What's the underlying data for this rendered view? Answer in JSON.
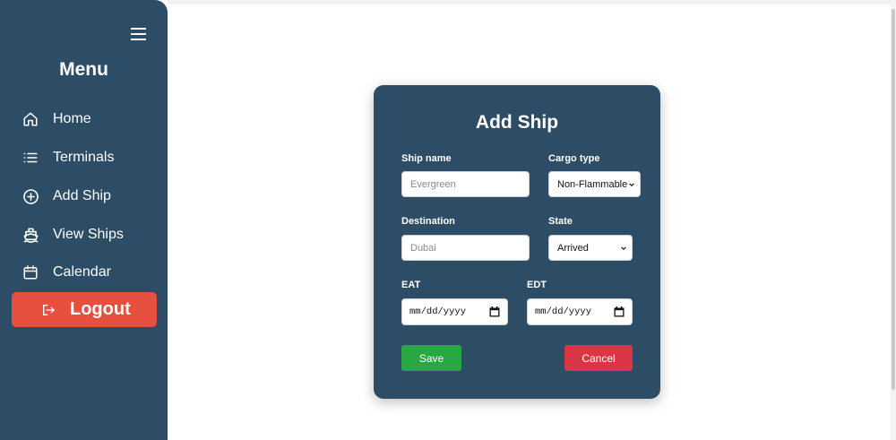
{
  "sidebar": {
    "title": "Menu",
    "items": [
      {
        "label": "Home",
        "icon": "home-icon"
      },
      {
        "label": "Terminals",
        "icon": "list-icon"
      },
      {
        "label": "Add Ship",
        "icon": "plus-circle-icon"
      },
      {
        "label": "View Ships",
        "icon": "ship-icon"
      },
      {
        "label": "Calendar",
        "icon": "calendar-icon"
      }
    ],
    "logout_label": "Logout"
  },
  "form": {
    "title": "Add Ship",
    "ship_name": {
      "label": "Ship name",
      "placeholder": "Evergreen"
    },
    "cargo_type": {
      "label": "Cargo type",
      "value": "Non-Flammable"
    },
    "destination": {
      "label": "Destination",
      "placeholder": "Dubai"
    },
    "state": {
      "label": "State",
      "value": "Arrived"
    },
    "eat": {
      "label": "EAT",
      "value": "mm/dd/yyyy"
    },
    "edt": {
      "label": "EDT",
      "value": "mm/dd/yyyy"
    },
    "save_label": "Save",
    "cancel_label": "Cancel"
  },
  "colors": {
    "sidebar_bg": "#2d4c65",
    "logout": "#e7503f",
    "save": "#28a745",
    "cancel": "#dc3545"
  }
}
